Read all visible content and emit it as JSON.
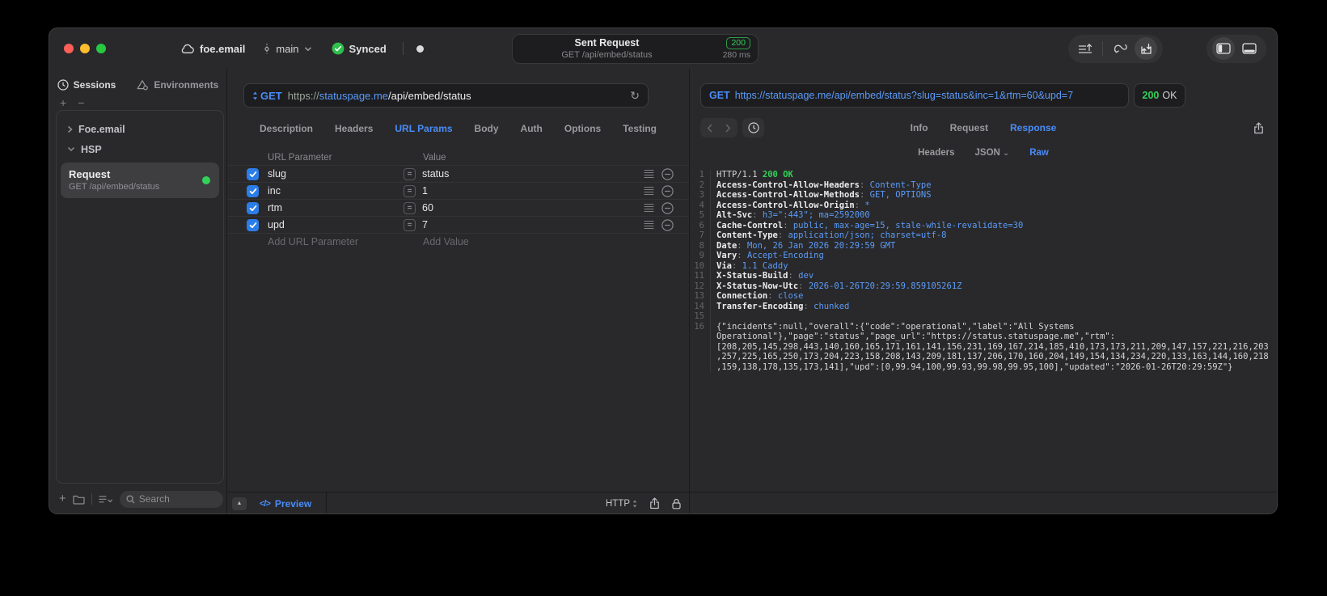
{
  "titlebar": {
    "project": "foe.email",
    "branch": "main",
    "sync_status": "Synced",
    "request_summary": {
      "title": "Sent Request",
      "subtitle": "GET /api/embed/status",
      "status_code": "200",
      "duration": "280 ms"
    }
  },
  "sidebar": {
    "tabs": [
      {
        "label": "Sessions"
      },
      {
        "label": "Environments"
      }
    ],
    "add_label": "+",
    "remove_label": "−",
    "groups": [
      {
        "label": "Foe.email"
      },
      {
        "label": "HSP"
      }
    ],
    "request_item": {
      "title": "Request",
      "subtitle": "GET /api/embed/status"
    },
    "search_placeholder": "Search"
  },
  "request_editor": {
    "method": "GET",
    "url": {
      "scheme": "https://",
      "host": "statuspage.me",
      "path": "/api/embed/status"
    },
    "tabs": [
      "Description",
      "Headers",
      "URL Params",
      "Body",
      "Auth",
      "Options",
      "Testing"
    ],
    "active_tab": "URL Params",
    "params": {
      "columns": [
        "URL Parameter",
        "Value"
      ],
      "rows": [
        {
          "name": "slug",
          "value": "status",
          "enabled": true
        },
        {
          "name": "inc",
          "value": "1",
          "enabled": true
        },
        {
          "name": "rtm",
          "value": "60",
          "enabled": true
        },
        {
          "name": "upd",
          "value": "7",
          "enabled": true
        }
      ],
      "add_name_placeholder": "Add URL Parameter",
      "add_value_placeholder": "Add Value"
    },
    "footer": {
      "preview_label": "Preview",
      "preview_glyph": "</>",
      "protocol": "HTTP"
    }
  },
  "response_viewer": {
    "method": "GET",
    "url": "https://statuspage.me/api/embed/status?slug=status&inc=1&rtm=60&upd=7",
    "status_code": "200",
    "status_text": "OK",
    "tabs": [
      "Info",
      "Request",
      "Response"
    ],
    "active_tab": "Response",
    "subtabs": [
      "Headers",
      "JSON",
      "Raw"
    ],
    "active_subtab": "Raw",
    "http_status_line": {
      "protocol": "HTTP/1.1",
      "status": "200 OK"
    },
    "headers": [
      {
        "name": "Access-Control-Allow-Headers",
        "value": "Content-Type"
      },
      {
        "name": "Access-Control-Allow-Methods",
        "value": "GET, OPTIONS"
      },
      {
        "name": "Access-Control-Allow-Origin",
        "value": "*"
      },
      {
        "name": "Alt-Svc",
        "value": "h3=\":443\"; ma=2592000"
      },
      {
        "name": "Cache-Control",
        "value": "public, max-age=15, stale-while-revalidate=30"
      },
      {
        "name": "Content-Type",
        "value": "application/json; charset=utf-8"
      },
      {
        "name": "Date",
        "value": "Mon, 26 Jan 2026 20:29:59 GMT"
      },
      {
        "name": "Vary",
        "value": "Accept-Encoding"
      },
      {
        "name": "Via",
        "value": "1.1 Caddy"
      },
      {
        "name": "X-Status-Build",
        "value": "dev"
      },
      {
        "name": "X-Status-Now-Utc",
        "value": "2026-01-26T20:29:59.859105261Z"
      },
      {
        "name": "Connection",
        "value": "close"
      },
      {
        "name": "Transfer-Encoding",
        "value": "chunked"
      }
    ],
    "body": "{\"incidents\":null,\"overall\":{\"code\":\"operational\",\"label\":\"All Systems Operational\"},\"page\":\"status\",\"page_url\":\"https://status.statuspage.me\",\"rtm\":[208,205,145,298,443,140,160,165,171,161,141,156,231,169,167,214,185,410,173,173,211,209,147,157,221,216,203,257,225,165,250,173,204,223,158,208,143,209,181,137,206,170,160,204,149,154,134,234,220,133,163,144,160,218,159,138,178,135,173,141],\"upd\":[0,99.94,100,99.93,99.98,99.95,100],\"updated\":\"2026-01-26T20:29:59Z\"}"
  },
  "colors": {
    "accent_blue": "#4a8cf7",
    "status_green": "#32d158"
  }
}
